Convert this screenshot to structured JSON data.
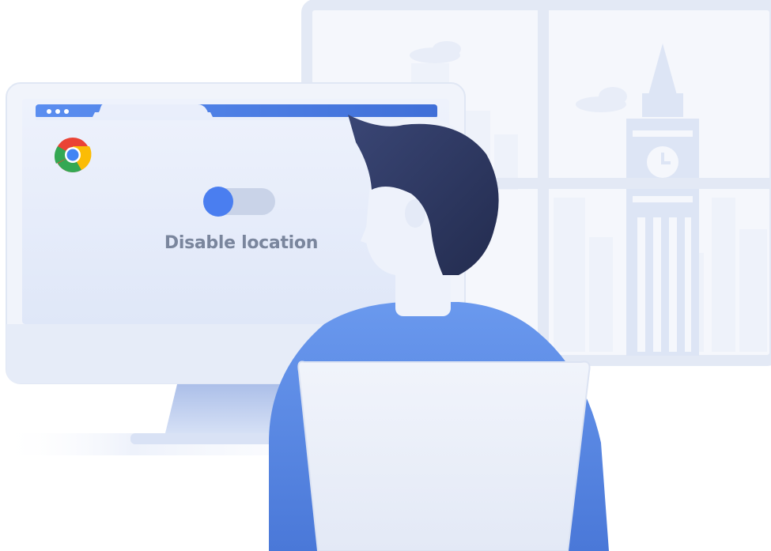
{
  "screen": {
    "toggle_label": "Disable location",
    "toggle_state": "off"
  },
  "icons": {
    "browser_logo": "chrome-icon",
    "window_dots": "window-dots-icon",
    "clock_tower": "clock-tower-icon",
    "cloud": "cloud-icon"
  },
  "colors": {
    "accent_blue": "#4a7ef0",
    "shirt_blue": "#5b8ce8",
    "hair_navy": "#2e3860",
    "label_gray": "#7a869d",
    "window_frame": "#e6ebf6",
    "monitor_screen": "#e8eefb",
    "toggle_track": "#c9d3e8"
  }
}
